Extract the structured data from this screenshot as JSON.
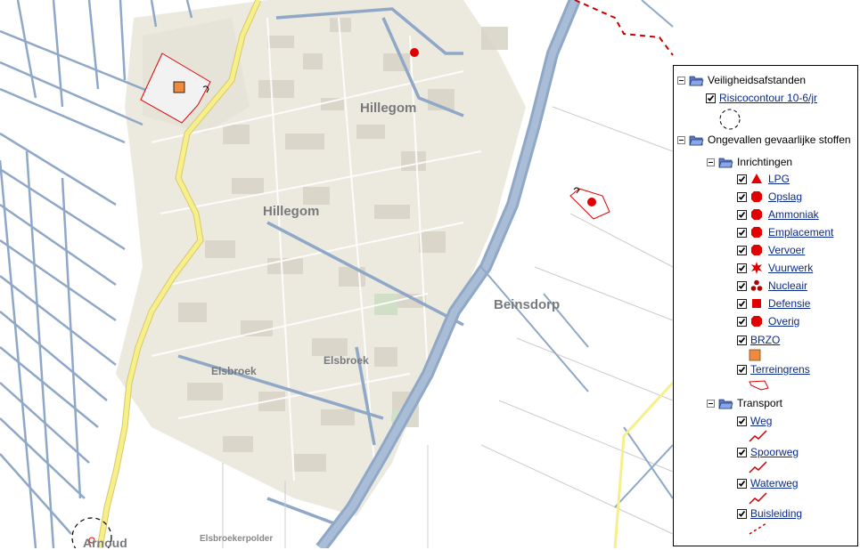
{
  "map": {
    "place_labels": [
      {
        "key": "hillegom_1",
        "text": "Hillegom"
      },
      {
        "key": "hillegom_2",
        "text": "Hillegom"
      },
      {
        "key": "beinsdorp",
        "text": "Beinsdorp"
      },
      {
        "key": "elsbroek_1",
        "text": "Elsbroek"
      },
      {
        "key": "elsbroek_2",
        "text": "Elsbroek"
      },
      {
        "key": "elsbroekerpolder",
        "text": "Elsbroekerpolder"
      },
      {
        "key": "arnoud",
        "text": "Arnoud"
      }
    ],
    "colors": {
      "water": "#8fa8c8",
      "road_yellow": "#f7ef8a",
      "urban": "#ece9df",
      "risk_red": "#e00000",
      "brzo_orange": "#f08a3c",
      "transport_dash": "#cc0000"
    }
  },
  "legend": {
    "groups": [
      {
        "label": "Veiligheidsafstanden",
        "icon": "folder-icon",
        "items": [
          {
            "label": "Risicocontour 10-6/jr",
            "checked": true,
            "symbol": "dashed-circle"
          }
        ]
      },
      {
        "label": "Ongevallen gevaarlijke stoffen",
        "icon": "folder-icon",
        "subgroups": [
          {
            "label": "Inrichtingen",
            "items": [
              {
                "label": "LPG",
                "checked": true,
                "symbol": "red-triangle"
              },
              {
                "label": "Opslag",
                "checked": true,
                "symbol": "red-octagon"
              },
              {
                "label": "Ammoniak",
                "checked": true,
                "symbol": "red-octagon"
              },
              {
                "label": "Emplacement",
                "checked": true,
                "symbol": "red-octagon"
              },
              {
                "label": "Vervoer",
                "checked": true,
                "symbol": "red-octagon"
              },
              {
                "label": "Vuurwerk",
                "checked": true,
                "symbol": "red-burst"
              },
              {
                "label": "Nucleair",
                "checked": true,
                "symbol": "red-trefoil"
              },
              {
                "label": "Defensie",
                "checked": true,
                "symbol": "red-square"
              },
              {
                "label": "Overig",
                "checked": true,
                "symbol": "red-octagon"
              }
            ],
            "extra_items": [
              {
                "label": "BRZO",
                "checked": true,
                "symbol": "orange-square"
              },
              {
                "label": "Terreingrens",
                "checked": true,
                "symbol": "red-outline-polygon"
              }
            ]
          },
          {
            "label": "Transport",
            "items": [
              {
                "label": "Weg",
                "checked": true,
                "symbol": "red-line"
              },
              {
                "label": "Spoorweg",
                "checked": true,
                "symbol": "red-line"
              },
              {
                "label": "Waterweg",
                "checked": true,
                "symbol": "red-line"
              },
              {
                "label": "Buisleiding",
                "checked": true,
                "symbol": "red-dashed-line"
              }
            ]
          }
        ]
      }
    ]
  }
}
